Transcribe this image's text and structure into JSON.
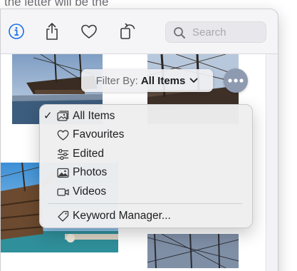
{
  "background": {
    "partial_text": "the letter will be the"
  },
  "toolbar": {
    "info_icon": "info-circle-icon",
    "share_icon": "share-icon",
    "favourite_icon": "heart-icon",
    "rotate_icon": "rotate-icon",
    "search": {
      "placeholder": "Search"
    }
  },
  "filter": {
    "label": "Filter By:",
    "value": "All Items"
  },
  "menu": {
    "items": [
      {
        "label": "All Items",
        "icon": "photo-library-icon",
        "checked": true
      },
      {
        "label": "Favourites",
        "icon": "heart-icon",
        "checked": false
      },
      {
        "label": "Edited",
        "icon": "sliders-icon",
        "checked": false
      },
      {
        "label": "Photos",
        "icon": "photo-icon",
        "checked": false
      },
      {
        "label": "Videos",
        "icon": "video-icon",
        "checked": false
      }
    ],
    "keyword_manager": {
      "label": "Keyword Manager...",
      "icon": "tag-icon"
    }
  },
  "colors": {
    "accent": "#1a6fe6",
    "menu_background": "#eeeef0",
    "more_button": "#8e9ab0"
  }
}
